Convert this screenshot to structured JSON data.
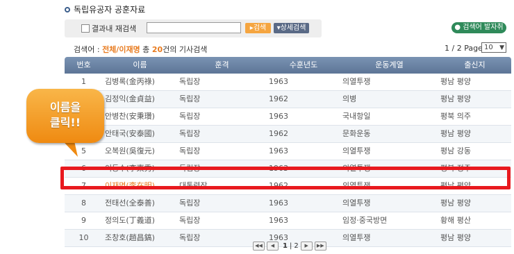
{
  "header": {
    "title": "독립유공자 공훈자료"
  },
  "search": {
    "checkbox_label": "결과내 재검색",
    "input_value": "",
    "search_button": "검색",
    "advanced_button": "상세검색",
    "keyword_button": "검색어 발자취"
  },
  "summary": {
    "prefix": "검색어 : ",
    "keyword": "전체/이재명",
    "middle": " 총 ",
    "count": "20",
    "suffix": "건의 기사검색",
    "page_info": "1 / 2 Page",
    "per_page": "10"
  },
  "table": {
    "headers": [
      "번호",
      "이름",
      "훈격",
      "수훈년도",
      "운동계열",
      "출신지"
    ],
    "rows": [
      [
        "1",
        "김병록(金丙祿)",
        "독립장",
        "1963",
        "의열투쟁",
        "평남 평양"
      ],
      [
        "2",
        "김정익(金貞益)",
        "독립장",
        "1962",
        "의병",
        "평남 평양"
      ],
      [
        "3",
        "안병찬(安秉瓚)",
        "독립장",
        "1963",
        "국내항일",
        "평북 의주"
      ],
      [
        "4",
        "안태국(安泰國)",
        "독립장",
        "1962",
        "문화운동",
        "평남 평양"
      ],
      [
        "5",
        "오복원(吳復元)",
        "독립장",
        "1963",
        "의열투쟁",
        "평남 강동"
      ],
      [
        "6",
        "이동수(李東秀)",
        "독립장",
        "1963",
        "의열투쟁",
        "평북 정주"
      ],
      [
        "7",
        "이재명(李在明)",
        "대통령장",
        "1962",
        "의열투쟁",
        "평남 평양"
      ],
      [
        "8",
        "전태선(全泰善)",
        "독립장",
        "1963",
        "의열투쟁",
        "평남 평양"
      ],
      [
        "9",
        "정의도(丁義道)",
        "독립장",
        "1963",
        "임정·중국방면",
        "황해 평산"
      ],
      [
        "10",
        "조창호(趙昌鎬)",
        "독립장",
        "1963",
        "의열투쟁",
        "평남 평양"
      ]
    ]
  },
  "callout": {
    "line1": "이름을",
    "line2": "클릭!!"
  },
  "pagination": {
    "current": "1",
    "next": "2",
    "separator": "|"
  },
  "colors": {
    "accent_orange": "#e87b1f",
    "highlight_red": "#e8191e",
    "header_blue": "#6a83a5",
    "callout_orange": "#f29a20"
  }
}
